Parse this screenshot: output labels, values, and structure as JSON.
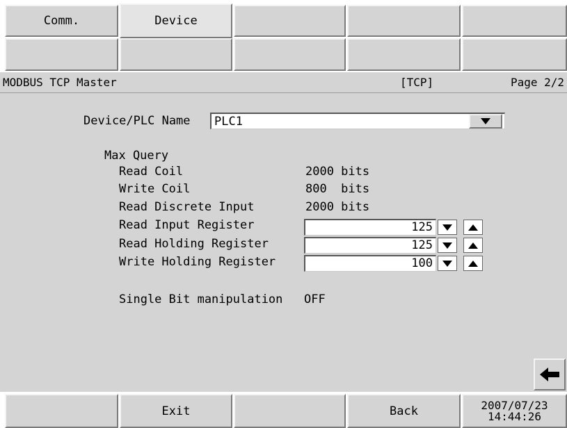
{
  "tabs": {
    "comm_label": "Comm.",
    "device_label": "Device"
  },
  "status": {
    "protocol": "MODBUS TCP Master",
    "mode": "[TCP]",
    "page": "Page 2/2"
  },
  "device": {
    "label": "Device/PLC Name",
    "value": "PLC1"
  },
  "max_query": {
    "heading": "Max Query",
    "read_coil": {
      "label": "Read Coil",
      "value": "2000 bits"
    },
    "write_coil": {
      "label": "Write Coil",
      "value": "800  bits"
    },
    "read_discrete_input": {
      "label": "Read Discrete Input",
      "value": "2000 bits"
    },
    "read_input_register": {
      "label": "Read Input Register",
      "value": "125"
    },
    "read_holding_register": {
      "label": "Read Holding Register",
      "value": "125"
    },
    "write_holding_register": {
      "label": "Write Holding Register",
      "value": "100"
    }
  },
  "single_bit": {
    "label": "Single Bit manipulation",
    "value": "OFF"
  },
  "footer": {
    "exit_label": "Exit",
    "back_label": "Back",
    "date": "2007/07/23",
    "time": "14:44:26"
  },
  "icons": {
    "back_arrow": "left-arrow-icon",
    "dropdown": "triangle-down-icon"
  }
}
